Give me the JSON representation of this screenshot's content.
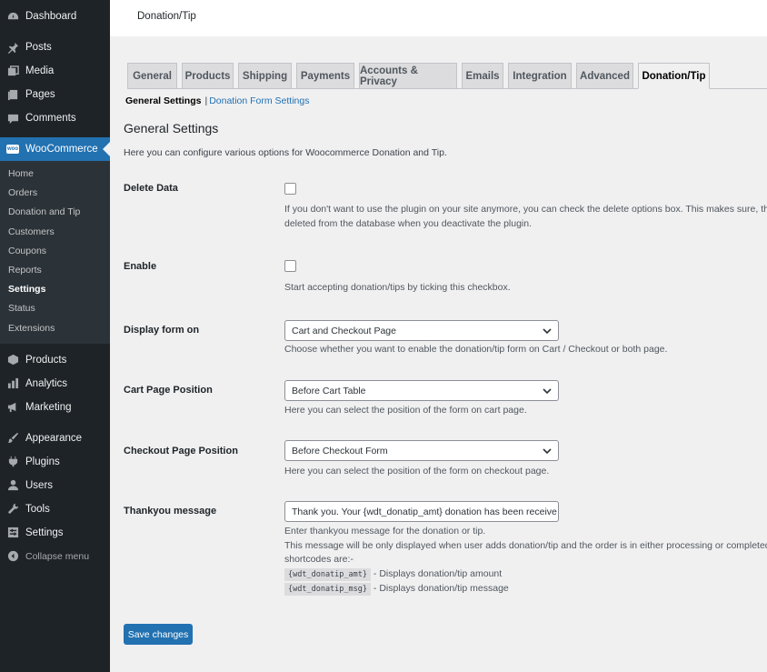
{
  "sidebar": {
    "top_items": [
      {
        "label": "Dashboard",
        "icon": "dashboard-icon"
      },
      {
        "label": "Posts",
        "icon": "pin-icon"
      },
      {
        "label": "Media",
        "icon": "media-icon"
      },
      {
        "label": "Pages",
        "icon": "pages-icon"
      },
      {
        "label": "Comments",
        "icon": "comment-icon"
      }
    ],
    "woocommerce": {
      "label": "WooCommerce",
      "badge": "woo"
    },
    "submenu": [
      "Home",
      "Orders",
      "Donation and Tip",
      "Customers",
      "Coupons",
      "Reports",
      "Settings",
      "Status",
      "Extensions"
    ],
    "active_submenu": "Settings",
    "mid_items": [
      {
        "label": "Products",
        "icon": "products-icon"
      },
      {
        "label": "Analytics",
        "icon": "analytics-icon"
      },
      {
        "label": "Marketing",
        "icon": "marketing-icon"
      }
    ],
    "bottom_items": [
      {
        "label": "Appearance",
        "icon": "appearance-icon"
      },
      {
        "label": "Plugins",
        "icon": "plugins-icon"
      },
      {
        "label": "Users",
        "icon": "users-icon"
      },
      {
        "label": "Tools",
        "icon": "tools-icon"
      },
      {
        "label": "Settings",
        "icon": "settings-icon"
      }
    ],
    "collapse_label": "Collapse menu"
  },
  "topbar": {
    "title": "Donation/Tip"
  },
  "tabs": [
    "General",
    "Products",
    "Shipping",
    "Payments",
    "Accounts & Privacy",
    "Emails",
    "Integration",
    "Advanced",
    "Donation/Tip"
  ],
  "active_tab": "Donation/Tip",
  "subnav": {
    "current": "General Settings",
    "separator": "|",
    "link": "Donation Form Settings"
  },
  "section": {
    "title": "General Settings",
    "intro": "Here you can configure various options for Woocommerce Donation and Tip."
  },
  "fields": {
    "delete_data": {
      "label": "Delete Data",
      "checked": false,
      "desc_line1": "If you don't want to use the plugin on your site anymore, you can check the delete options box. This makes sure, th",
      "desc_line2": "deleted from the database when you deactivate the plugin."
    },
    "enable": {
      "label": "Enable",
      "checked": false,
      "desc": "Start accepting donation/tips by ticking this checkbox."
    },
    "display_form_on": {
      "label": "Display form on",
      "value": "Cart and Checkout Page",
      "desc": "Choose whether you want to enable the donation/tip form on Cart / Checkout or both page."
    },
    "cart_page_position": {
      "label": "Cart Page Position",
      "value": "Before Cart Table",
      "desc": "Here you can select the position of the form on cart page."
    },
    "checkout_page_position": {
      "label": "Checkout Page Position",
      "value": "Before Checkout Form",
      "desc": "Here you can select the position of the form on checkout page."
    },
    "thankyou_message": {
      "label": "Thankyou message",
      "value": "Thank you. Your {wdt_donatip_amt} donation has been receive",
      "desc_line1": "Enter thankyou message for the donation or tip.",
      "desc_line2": "This message will be only displayed when user adds donation/tip and the order is in either processing or completed",
      "desc_line3": "shortcodes are:-",
      "shortcodes": [
        {
          "code": "{wdt_donatip_amt}",
          "text": "- Displays donation/tip amount"
        },
        {
          "code": "{wdt_donatip_msg}",
          "text": "- Displays donation/tip message"
        }
      ]
    }
  },
  "save_button": "Save changes",
  "colors": {
    "sidebar": "#1d2327",
    "accent": "#2271b1",
    "background": "#f0f0f1"
  }
}
